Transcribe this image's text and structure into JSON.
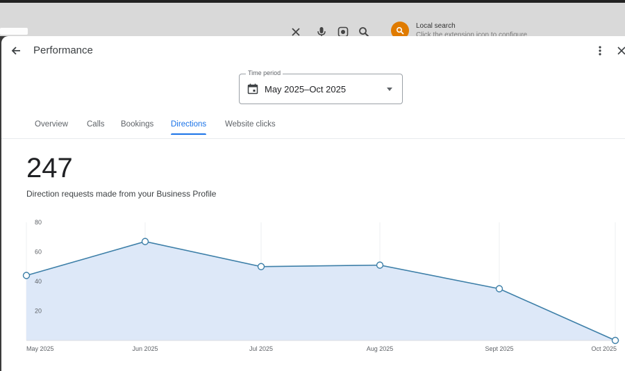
{
  "browser": {
    "extension_title": "Local search",
    "extension_subtitle": "Click the extension icon to configure"
  },
  "header": {
    "title": "Performance"
  },
  "time_period": {
    "label": "Time period",
    "value": "May 2025–Oct 2025"
  },
  "tabs": [
    {
      "label": "Overview"
    },
    {
      "label": "Calls"
    },
    {
      "label": "Bookings"
    },
    {
      "label": "Directions",
      "active": true
    },
    {
      "label": "Website clicks"
    }
  ],
  "summary": {
    "total": "247",
    "description": "Direction requests made from your Business Profile"
  },
  "colors": {
    "accent": "#1a73e8",
    "line": "#3d7fa8",
    "area": "#dde8f8"
  },
  "chart_data": {
    "type": "area",
    "categories": [
      "May 2025",
      "Jun 2025",
      "Jul 2025",
      "Aug 2025",
      "Sept 2025",
      "Oct 2025"
    ],
    "values": [
      44,
      67,
      50,
      51,
      35,
      0
    ],
    "yticks": [
      20,
      40,
      60,
      80
    ],
    "ylim": [
      0,
      80
    ],
    "grid": true
  }
}
